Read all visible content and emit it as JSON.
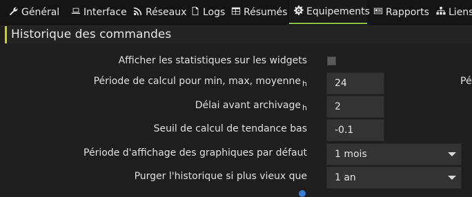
{
  "tabs": [
    {
      "label": "Général",
      "icon": "wrench-icon"
    },
    {
      "label": "Interface",
      "icon": "laptop-icon"
    },
    {
      "label": "Réseaux",
      "icon": "rss-icon"
    },
    {
      "label": "Logs",
      "icon": "file-icon"
    },
    {
      "label": "Résumés",
      "icon": "table-icon"
    },
    {
      "label": "Equipements",
      "icon": "gear-icon",
      "active": true
    },
    {
      "label": "Rapports",
      "icon": "newspaper-icon"
    },
    {
      "label": "Liens",
      "icon": "sitemap-icon"
    }
  ],
  "section": {
    "title": "Historique des commandes"
  },
  "form": {
    "show_stats_label": "Afficher les statistiques sur les widgets",
    "period_label": "Période de calcul pour min, max, moyenne",
    "period_unit": "h",
    "period_value": "24",
    "archive_delay_label": "Délai avant archivage",
    "archive_delay_unit": "h",
    "archive_delay_value": "2",
    "trend_label": "Seuil de calcul de tendance bas",
    "trend_value": "-0.1",
    "graph_period_label": "Période d'affichage des graphiques par défaut",
    "graph_period_value": "1 mois",
    "purge_label": "Purger l'historique si plus vieux que",
    "purge_value": "1 an",
    "clipped_label": "Pé"
  },
  "colors": {
    "accent": "#8fbf3f",
    "section_bar": "#c4d21c",
    "background": "#1e1e1e"
  }
}
